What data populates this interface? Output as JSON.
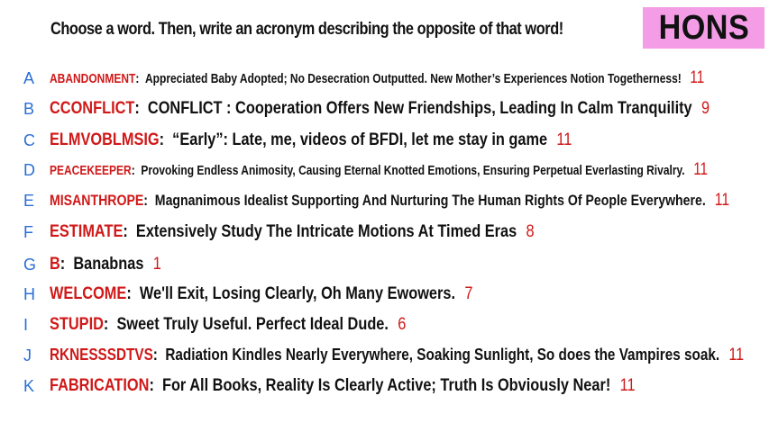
{
  "prompt": "Choose a word. Then, write an acronym describing the opposite of that word!",
  "badge": "HONS",
  "colors": {
    "badge_bg": "#f59ce6",
    "word": "#d01818",
    "letter": "#2a6fd6",
    "count": "#d01818"
  },
  "entries": [
    {
      "letter": "A",
      "word": "ABANDONMENT",
      "desc": "Appreciated Baby Adopted; No Desecration Outputted. New Mother’s Experiences Notion Togetherness!",
      "count": "11"
    },
    {
      "letter": "B",
      "word": "CCONFLICT",
      "desc": "CONFLICT : Cooperation Offers New Friendships, Leading In Calm Tranquility",
      "count": "9"
    },
    {
      "letter": "C",
      "word": "ELMVOBLMSIG",
      "desc": "“Early”: Late,  me, videos of BFDI, let me stay in game",
      "count": "11"
    },
    {
      "letter": "D",
      "word": "PEACEKEEPER",
      "desc": "Provoking Endless Animosity, Causing Eternal Knotted Emotions, Ensuring Perpetual Everlasting Rivalry.",
      "count": "11"
    },
    {
      "letter": "E",
      "word": "MISANTHROPE",
      "desc": "Magnanimous Idealist Supporting And Nurturing The Human Rights Of People Everywhere.",
      "count": "11"
    },
    {
      "letter": "F",
      "word": "ESTIMATE",
      "desc": "Extensively Study The Intricate Motions At Timed Eras",
      "count": "8"
    },
    {
      "letter": "G",
      "word": "B",
      "desc": "Banabnas",
      "count": "1"
    },
    {
      "letter": "H",
      "word": "WELCOME",
      "desc": "We'll Exit, Losing Clearly, Oh Many Ewowers.",
      "count": "7"
    },
    {
      "letter": "I",
      "word": "STUPID",
      "desc": "Sweet Truly Useful. Perfect Ideal Dude.",
      "count": "6"
    },
    {
      "letter": "J",
      "word": "RKNESSSDTVS",
      "desc": "Radiation Kindles Nearly Everywhere, Soaking Sunlight, So does the Vampires soak.",
      "count": "11"
    },
    {
      "letter": "K",
      "word": "FABRICATION",
      "desc": "For All Books, Reality Is Clearly Active; Truth Is Obviously Near!",
      "count": "11"
    }
  ]
}
